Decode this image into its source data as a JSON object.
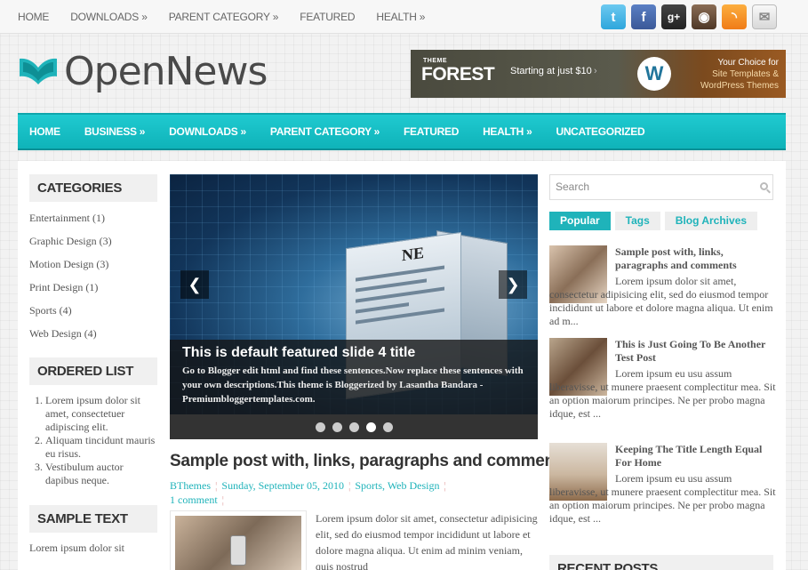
{
  "topnav": [
    "HOME",
    "DOWNLOADS »",
    "PARENT CATEGORY »",
    "FEATURED",
    "HEALTH »"
  ],
  "socials": {
    "twitter_glyph": "t",
    "facebook_glyph": "f",
    "googleplus_glyph": "g+",
    "instagram_glyph": "◉",
    "rss_glyph": "◝",
    "mail_glyph": "✉"
  },
  "logo": {
    "text": "OpenNews",
    "icon": "open-book-icon",
    "color": "#1fb3ba"
  },
  "banner": {
    "brand_top": "THEME",
    "brand_bottom": "FOREST",
    "starting": "Starting at just $10",
    "choice_line1": "Your Choice for",
    "choice_line2": "Site Templates &",
    "choice_line3": "WordPress Themes"
  },
  "mainnav": [
    "HOME",
    "BUSINESS »",
    "DOWNLOADS »",
    "PARENT CATEGORY »",
    "FEATURED",
    "HEALTH »",
    "UNCATEGORIZED"
  ],
  "categories": {
    "title": "CATEGORIES",
    "items": [
      "Entertainment (1)",
      "Graphic Design (3)",
      "Motion Design (3)",
      "Print Design (1)",
      "Sports (4)",
      "Web Design (4)"
    ]
  },
  "ordered_list": {
    "title": "ORDERED LIST",
    "items": [
      "Lorem ipsum dolor sit amet, consectetuer adipiscing elit.",
      "Aliquam tincidunt mauris eu risus.",
      "Vestibulum auctor dapibus neque."
    ]
  },
  "sample_text": {
    "title": "SAMPLE TEXT",
    "body": "Lorem ipsum dolor sit"
  },
  "slider": {
    "title": "This is default featured slide 4 title",
    "description": "Go to Blogger edit html and find these sentences.Now replace these sentences with your own descriptions.This theme is Bloggerized by Lasantha Bandara - Premiumbloggertemplates.com.",
    "prev": "❮",
    "next": "❯",
    "active_slide": 4,
    "slide_count": 5,
    "paper_heading": "NE"
  },
  "post": {
    "title": "Sample post with, links, paragraphs and comments",
    "author": "BThemes",
    "date": "Sunday, September 05, 2010",
    "labels": "Sports, Web Design",
    "comments": "1 comment",
    "excerpt": "Lorem ipsum dolor sit amet, consectetur adipisicing elit, sed do eiusmod tempor incididunt ut labore et dolore magna aliqua. Ut enim ad minim veniam, quis nostrud"
  },
  "search": {
    "placeholder": "Search"
  },
  "tabs": [
    "Popular",
    "Tags",
    "Blog Archives"
  ],
  "popular": [
    {
      "title": "Sample post with, links, paragraphs and comments",
      "text": "Lorem ipsum dolor sit amet, consectetur adipisicing elit, sed do eiusmod tempor incididunt ut labore et dolore magna aliqua. Ut enim ad m..."
    },
    {
      "title": "This is Just Going To Be Another Test Post",
      "text": "Lorem ipsum eu usu assum liberavisse, ut munere praesent complectitur mea. Sit an option maiorum principes. Ne per probo magna idque, est ..."
    },
    {
      "title": "Keeping The Title Length Equal For Home",
      "text": "Lorem ipsum eu usu assum liberavisse, ut munere praesent complectitur mea. Sit an option maiorum principes. Ne per probo magna idque, est ..."
    }
  ],
  "recent_posts": {
    "title": "RECENT POSTS"
  }
}
